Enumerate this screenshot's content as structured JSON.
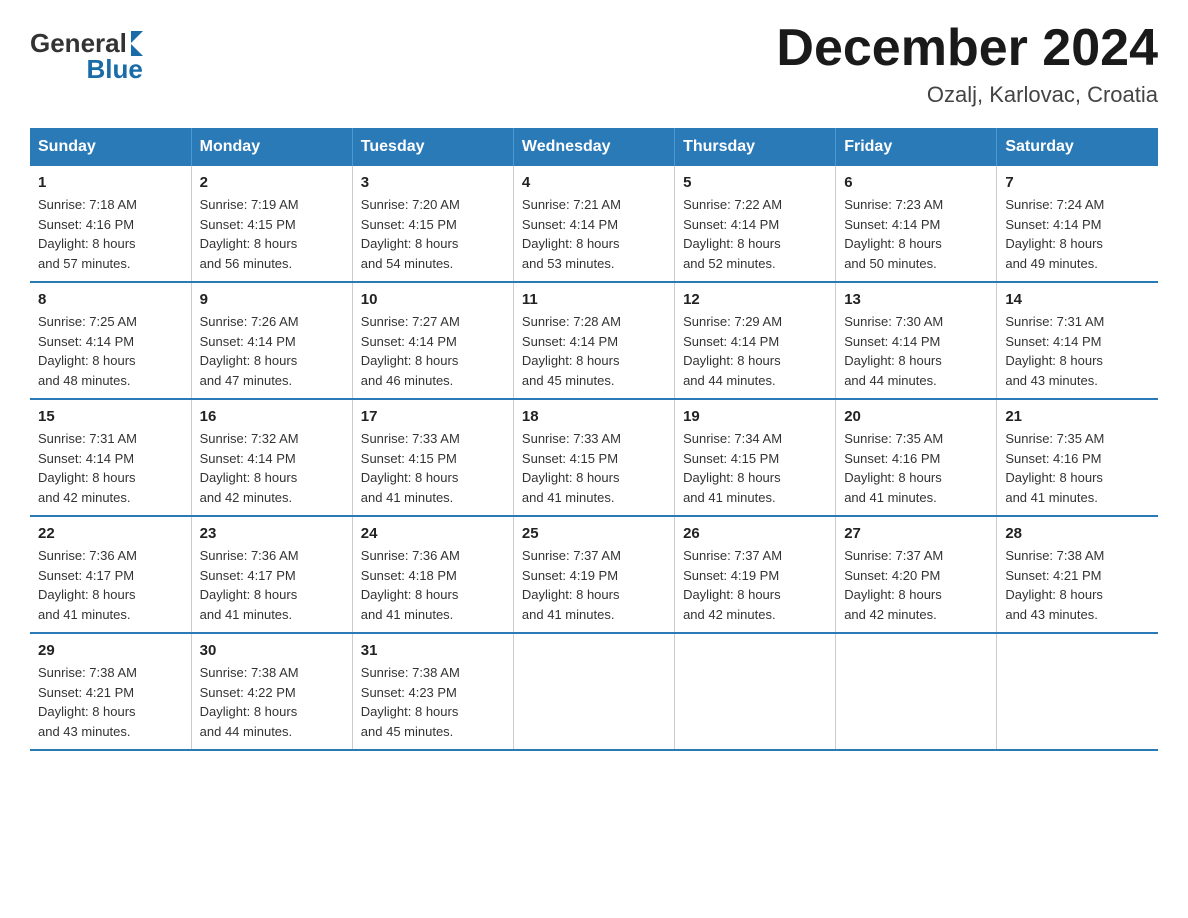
{
  "logo": {
    "general": "General",
    "blue": "Blue"
  },
  "title": "December 2024",
  "location": "Ozalj, Karlovac, Croatia",
  "days_of_week": [
    "Sunday",
    "Monday",
    "Tuesday",
    "Wednesday",
    "Thursday",
    "Friday",
    "Saturday"
  ],
  "weeks": [
    [
      {
        "day": "1",
        "sunrise": "7:18 AM",
        "sunset": "4:16 PM",
        "daylight": "8 hours and 57 minutes."
      },
      {
        "day": "2",
        "sunrise": "7:19 AM",
        "sunset": "4:15 PM",
        "daylight": "8 hours and 56 minutes."
      },
      {
        "day": "3",
        "sunrise": "7:20 AM",
        "sunset": "4:15 PM",
        "daylight": "8 hours and 54 minutes."
      },
      {
        "day": "4",
        "sunrise": "7:21 AM",
        "sunset": "4:14 PM",
        "daylight": "8 hours and 53 minutes."
      },
      {
        "day": "5",
        "sunrise": "7:22 AM",
        "sunset": "4:14 PM",
        "daylight": "8 hours and 52 minutes."
      },
      {
        "day": "6",
        "sunrise": "7:23 AM",
        "sunset": "4:14 PM",
        "daylight": "8 hours and 50 minutes."
      },
      {
        "day": "7",
        "sunrise": "7:24 AM",
        "sunset": "4:14 PM",
        "daylight": "8 hours and 49 minutes."
      }
    ],
    [
      {
        "day": "8",
        "sunrise": "7:25 AM",
        "sunset": "4:14 PM",
        "daylight": "8 hours and 48 minutes."
      },
      {
        "day": "9",
        "sunrise": "7:26 AM",
        "sunset": "4:14 PM",
        "daylight": "8 hours and 47 minutes."
      },
      {
        "day": "10",
        "sunrise": "7:27 AM",
        "sunset": "4:14 PM",
        "daylight": "8 hours and 46 minutes."
      },
      {
        "day": "11",
        "sunrise": "7:28 AM",
        "sunset": "4:14 PM",
        "daylight": "8 hours and 45 minutes."
      },
      {
        "day": "12",
        "sunrise": "7:29 AM",
        "sunset": "4:14 PM",
        "daylight": "8 hours and 44 minutes."
      },
      {
        "day": "13",
        "sunrise": "7:30 AM",
        "sunset": "4:14 PM",
        "daylight": "8 hours and 44 minutes."
      },
      {
        "day": "14",
        "sunrise": "7:31 AM",
        "sunset": "4:14 PM",
        "daylight": "8 hours and 43 minutes."
      }
    ],
    [
      {
        "day": "15",
        "sunrise": "7:31 AM",
        "sunset": "4:14 PM",
        "daylight": "8 hours and 42 minutes."
      },
      {
        "day": "16",
        "sunrise": "7:32 AM",
        "sunset": "4:14 PM",
        "daylight": "8 hours and 42 minutes."
      },
      {
        "day": "17",
        "sunrise": "7:33 AM",
        "sunset": "4:15 PM",
        "daylight": "8 hours and 41 minutes."
      },
      {
        "day": "18",
        "sunrise": "7:33 AM",
        "sunset": "4:15 PM",
        "daylight": "8 hours and 41 minutes."
      },
      {
        "day": "19",
        "sunrise": "7:34 AM",
        "sunset": "4:15 PM",
        "daylight": "8 hours and 41 minutes."
      },
      {
        "day": "20",
        "sunrise": "7:35 AM",
        "sunset": "4:16 PM",
        "daylight": "8 hours and 41 minutes."
      },
      {
        "day": "21",
        "sunrise": "7:35 AM",
        "sunset": "4:16 PM",
        "daylight": "8 hours and 41 minutes."
      }
    ],
    [
      {
        "day": "22",
        "sunrise": "7:36 AM",
        "sunset": "4:17 PM",
        "daylight": "8 hours and 41 minutes."
      },
      {
        "day": "23",
        "sunrise": "7:36 AM",
        "sunset": "4:17 PM",
        "daylight": "8 hours and 41 minutes."
      },
      {
        "day": "24",
        "sunrise": "7:36 AM",
        "sunset": "4:18 PM",
        "daylight": "8 hours and 41 minutes."
      },
      {
        "day": "25",
        "sunrise": "7:37 AM",
        "sunset": "4:19 PM",
        "daylight": "8 hours and 41 minutes."
      },
      {
        "day": "26",
        "sunrise": "7:37 AM",
        "sunset": "4:19 PM",
        "daylight": "8 hours and 42 minutes."
      },
      {
        "day": "27",
        "sunrise": "7:37 AM",
        "sunset": "4:20 PM",
        "daylight": "8 hours and 42 minutes."
      },
      {
        "day": "28",
        "sunrise": "7:38 AM",
        "sunset": "4:21 PM",
        "daylight": "8 hours and 43 minutes."
      }
    ],
    [
      {
        "day": "29",
        "sunrise": "7:38 AM",
        "sunset": "4:21 PM",
        "daylight": "8 hours and 43 minutes."
      },
      {
        "day": "30",
        "sunrise": "7:38 AM",
        "sunset": "4:22 PM",
        "daylight": "8 hours and 44 minutes."
      },
      {
        "day": "31",
        "sunrise": "7:38 AM",
        "sunset": "4:23 PM",
        "daylight": "8 hours and 45 minutes."
      },
      null,
      null,
      null,
      null
    ]
  ]
}
